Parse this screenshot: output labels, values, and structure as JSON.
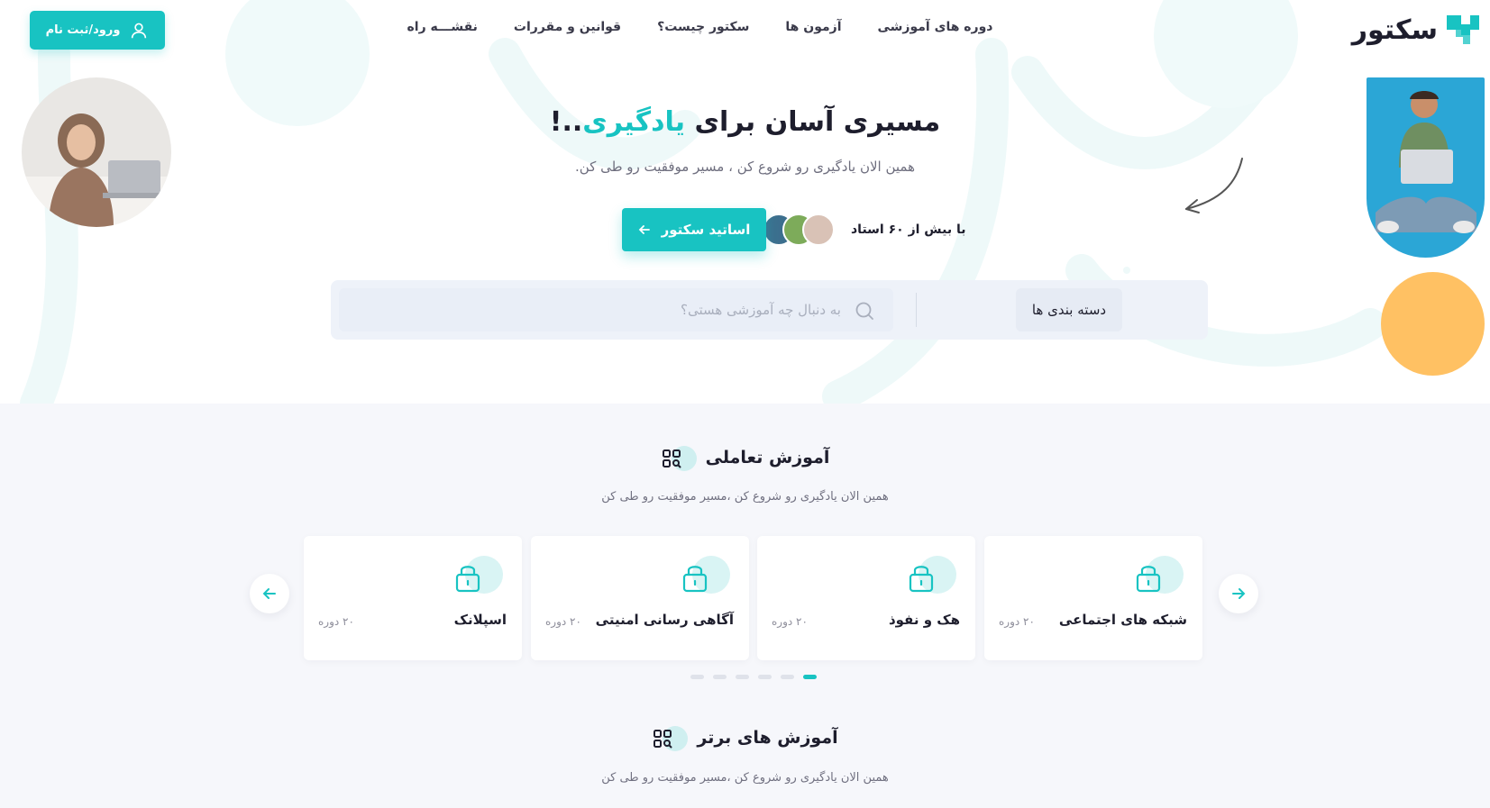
{
  "brand": {
    "name": "سکتور",
    "accent_color": "#18c3c2",
    "secondary_color": "#ffc163"
  },
  "nav": {
    "items": [
      {
        "label": "دوره های آموزشی"
      },
      {
        "label": "آزمون ها"
      },
      {
        "label": "سکتور چیست؟"
      },
      {
        "label": "قوانین و مقررات"
      },
      {
        "label": "نقشـــه راه"
      }
    ]
  },
  "login": {
    "label": "ورود/ثبت نام",
    "icon": "user-icon"
  },
  "hero": {
    "title_main": "مسیری آسان برای ",
    "title_accent": "یادگیری",
    "title_end": "..!",
    "subtitle": "همین الان یادگیری رو شروع کن ، مسیر موفقیت رو طی کن.",
    "teachers_label": "با بیش از ۶۰ استاد",
    "teachers_button": "اساتید سکتور"
  },
  "search": {
    "category_label": "دسته بندی ها",
    "placeholder": "به دنبال چه آموزشی هستی؟",
    "value": ""
  },
  "interactive": {
    "title": "آموزش تعاملی",
    "subtitle": "همین الان یادگیری رو شروع کن ،مسیر موفقیت رو طی کن",
    "cards": [
      {
        "title": "شبکه های اجتماعی",
        "count": "۲۰ دوره",
        "icon": "lock-icon"
      },
      {
        "title": "هک و نفوذ",
        "count": "۲۰ دوره",
        "icon": "lock-icon"
      },
      {
        "title": "آگاهی رسانی امنیتی",
        "count": "۲۰ دوره",
        "icon": "lock-icon"
      },
      {
        "title": "اسپلانک",
        "count": "۲۰ دوره",
        "icon": "lock-icon"
      }
    ],
    "pagination_count": 6,
    "active_page": 1
  },
  "top": {
    "title": "آموزش های برتر",
    "subtitle": "همین الان یادگیری رو شروع کن ،مسیر موفقیت رو طی کن"
  }
}
